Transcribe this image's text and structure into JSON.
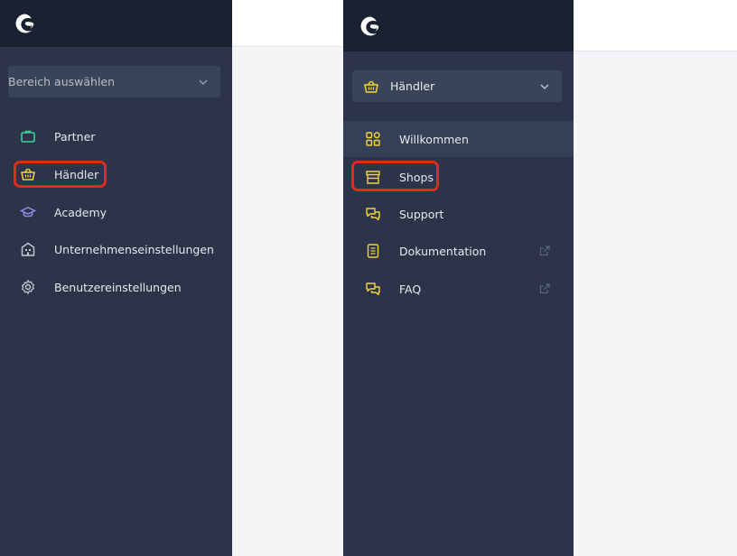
{
  "left": {
    "logo_icon": "shopware-logo-icon",
    "select": {
      "value": "Bereich auswählen",
      "icon": "chevron-down-icon"
    },
    "nav": [
      {
        "label": "Partner",
        "icon": "briefcase-icon",
        "color": "#3ccf9a"
      },
      {
        "label": "Händler",
        "icon": "basket-icon",
        "color": "#f5d23d"
      },
      {
        "label": "Academy",
        "icon": "graduation-cap-icon",
        "color": "#8f8ce6"
      },
      {
        "label": "Unternehmenseinstellungen",
        "icon": "building-icon",
        "color": "#c5cad6"
      },
      {
        "label": "Benutzereinstellungen",
        "icon": "gear-icon",
        "color": "#c5cad6"
      }
    ],
    "highlighted": "Händler"
  },
  "right": {
    "logo_icon": "shopware-logo-icon",
    "select": {
      "value": "Händler",
      "icon": "basket-icon",
      "chevron": "chevron-down-icon"
    },
    "nav": [
      {
        "label": "Willkommen",
        "icon": "dashboard-icon",
        "active": true
      },
      {
        "label": "Shops",
        "icon": "storefront-icon"
      },
      {
        "label": "Support",
        "icon": "chat-bubbles-icon"
      },
      {
        "label": "Dokumentation",
        "icon": "document-icon",
        "external": true
      },
      {
        "label": "FAQ",
        "icon": "chat-bubbles-icon",
        "external": true
      }
    ],
    "highlighted": "Shops"
  },
  "colors": {
    "sidebar_bg": "#2b3449",
    "logo_bar_bg": "#1a2232",
    "accent_yellow": "#f5d23d",
    "highlight_red": "#e02a1e"
  }
}
